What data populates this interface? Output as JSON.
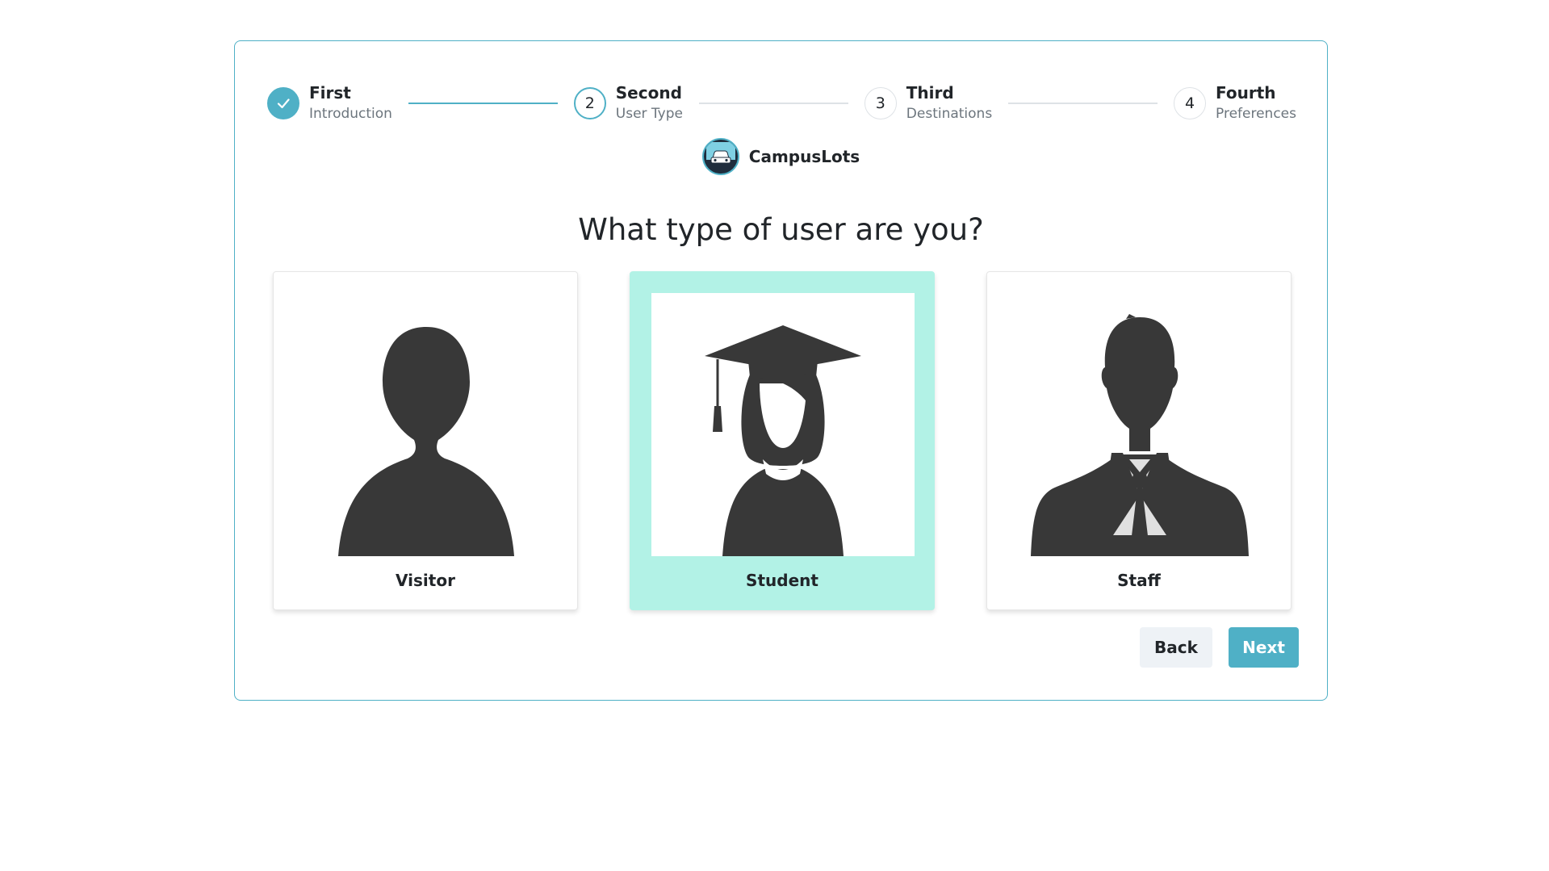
{
  "stepper": {
    "steps": [
      {
        "number": "1",
        "title": "First",
        "subtitle": "Introduction",
        "state": "done"
      },
      {
        "number": "2",
        "title": "Second",
        "subtitle": "User Type",
        "state": "active"
      },
      {
        "number": "3",
        "title": "Third",
        "subtitle": "Destinations",
        "state": "pending"
      },
      {
        "number": "4",
        "title": "Fourth",
        "subtitle": "Preferences",
        "state": "pending"
      }
    ]
  },
  "brand": {
    "name": "CampusLots",
    "logo_icon": "car-icon"
  },
  "question": "What type of user are you?",
  "options": [
    {
      "label": "Visitor",
      "icon": "person-silhouette-icon",
      "selected": false
    },
    {
      "label": "Student",
      "icon": "graduate-silhouette-icon",
      "selected": true
    },
    {
      "label": "Staff",
      "icon": "businessman-silhouette-icon",
      "selected": false
    }
  ],
  "buttons": {
    "back": "Back",
    "next": "Next"
  },
  "colors": {
    "accent": "#4fb0c6",
    "selected_bg": "#b2f2e6",
    "silhouette": "#383838"
  }
}
